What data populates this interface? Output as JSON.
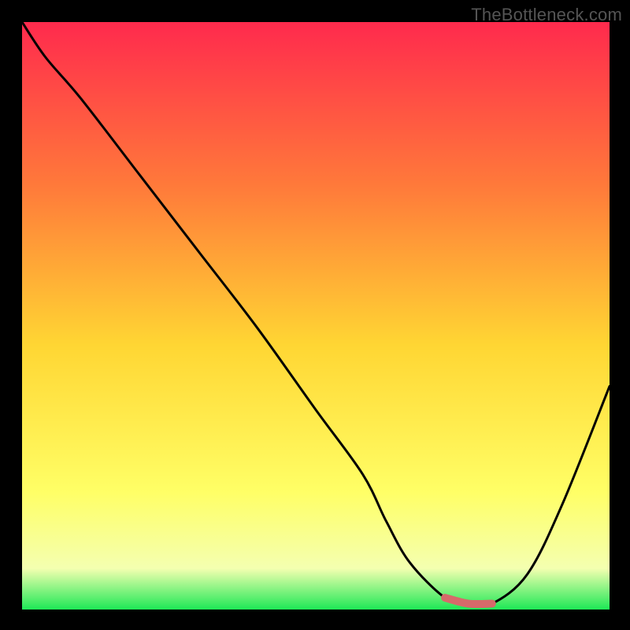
{
  "watermark": "TheBottleneck.com",
  "colors": {
    "top": "#ff2a4d",
    "mid_upper": "#ff7a3a",
    "mid": "#ffd633",
    "mid_lower": "#ffff66",
    "near_bottom": "#f4ffb0",
    "bottom": "#1ee856",
    "curve": "#000000",
    "valley_stroke": "#d66a6a",
    "background": "#000000"
  },
  "chart_data": {
    "type": "line",
    "title": "",
    "xlabel": "",
    "ylabel": "",
    "xlim": [
      0,
      100
    ],
    "ylim": [
      0,
      100
    ],
    "series": [
      {
        "name": "bottleneck-curve",
        "x": [
          0,
          4,
          10,
          20,
          30,
          40,
          50,
          58,
          62,
          66,
          72,
          76,
          80,
          86,
          92,
          100
        ],
        "values": [
          100,
          94,
          87,
          74,
          61,
          48,
          34,
          23,
          15,
          8,
          2,
          1,
          1,
          6,
          18,
          38
        ]
      }
    ],
    "annotations": [
      {
        "name": "valley-highlight",
        "x_start": 70,
        "x_end": 82,
        "y": 1
      }
    ]
  }
}
